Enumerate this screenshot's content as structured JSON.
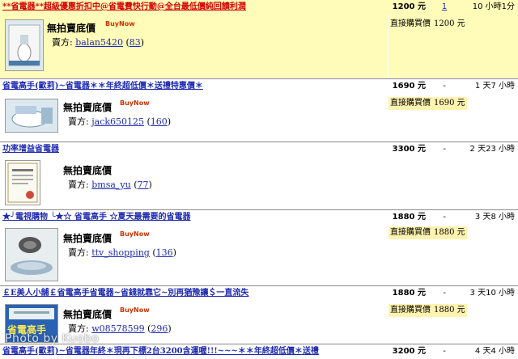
{
  "labels": {
    "no_auction": "無拍賣底價",
    "buy_now": "BuyNow",
    "seller_prefix": "賣方:",
    "direct_buy": "直接購買價",
    "currency": "元"
  },
  "listings": [
    {
      "title": "**省電器**超級優惠折扣中@省電費快行動@全台最低價純回饋利潤",
      "price": "1200",
      "bids": "1",
      "time_left": "10 小時1分",
      "seller": "balan5420",
      "rating": "83",
      "direct_price": "1200 元",
      "show_direct": true
    },
    {
      "title": "省電高手(歐莉)~省電器＊＊年終超低價＊送禮特惠價＊",
      "price": "1690",
      "bids": "-",
      "time_left": "1 天7 小時",
      "seller": "jack650125",
      "rating": "160",
      "direct_price": "1690 元",
      "show_direct": true
    },
    {
      "title": "功率增益省電器",
      "price": "3300",
      "bids": "-",
      "time_left": "2 天23 小時",
      "seller": "bmsa_yu",
      "rating": "77",
      "direct_price": "",
      "show_direct": false
    },
    {
      "title": "★╯電視購物 ╰★☆ 省電高手 ☆夏天最需要的省電器",
      "price": "1880",
      "bids": "-",
      "time_left": "3 天8 小時",
      "seller": "ttv_shopping",
      "rating": "136",
      "direct_price": "1880 元",
      "show_direct": true
    },
    {
      "title": "￡E美人小舖￡省電高手省電器~省錢就靠它~別再猶豫讓＄一直流失",
      "price": "1880",
      "bids": "-",
      "time_left": "3 天10 小時",
      "seller": "w08578599",
      "rating": "296",
      "direct_price": "1880 元",
      "show_direct": true
    },
    {
      "title": "省電高手(歐莉)~省電器年終＊現再下標2台3200含運喔!!!~~~＊＊年終超低價＊送禮",
      "price": "3200",
      "bids": "-",
      "time_left": "4 天4 小時",
      "seller": "",
      "rating": "",
      "direct_price": "",
      "show_direct": false
    }
  ],
  "thumb_text": {
    "brand_label": "省電高手",
    "cert_title": "國家證書"
  },
  "watermark": "Photo by Kuobo"
}
